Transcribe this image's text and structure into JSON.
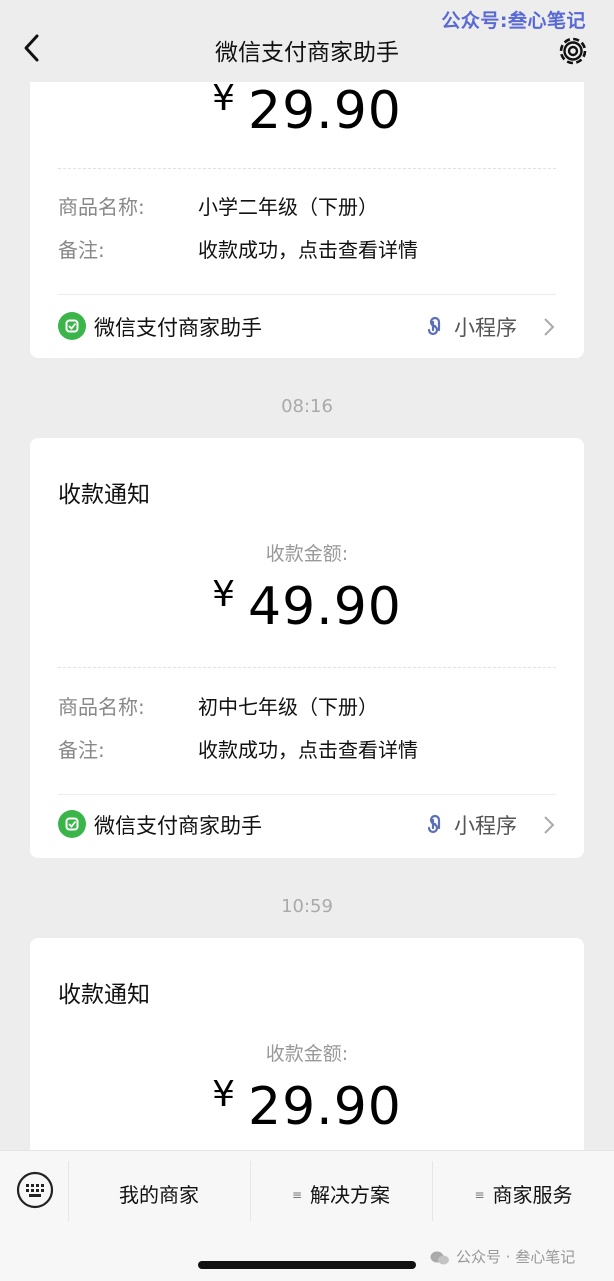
{
  "watermark_top": "公众号:叁心笔记",
  "header": {
    "title": "微信支付商家助手",
    "back_icon": "chevron-left-icon",
    "settings_icon": "gear-icon"
  },
  "messages": [
    {
      "amount_currency": "¥",
      "amount": "29.90",
      "fields": [
        {
          "key": "商品名称:",
          "value": "小学二年级（下册）"
        },
        {
          "key": "备注:",
          "value": "收款成功，点击查看详情"
        }
      ],
      "brand": "微信支付商家助手",
      "mini_program": "小程序"
    },
    {
      "time": "08:16",
      "title": "收款通知",
      "amount_label": "收款金额:",
      "amount_currency": "¥",
      "amount": "49.90",
      "fields": [
        {
          "key": "商品名称:",
          "value": "初中七年级（下册）"
        },
        {
          "key": "备注:",
          "value": "收款成功，点击查看详情"
        }
      ],
      "brand": "微信支付商家助手",
      "mini_program": "小程序"
    },
    {
      "time": "10:59",
      "title": "收款通知",
      "amount_label": "收款金额:",
      "amount_currency": "¥",
      "amount": "29.90"
    }
  ],
  "bottom_menu": {
    "keyboard_icon": "keyboard-icon",
    "items": [
      "我的商家",
      "解决方案",
      "商家服务"
    ]
  },
  "watermark_bottom": "公众号 · 叁心笔记",
  "colors": {
    "background": "#ededed",
    "brand_green": "#3bb54a",
    "watermark_blue": "#5a6ad4"
  }
}
